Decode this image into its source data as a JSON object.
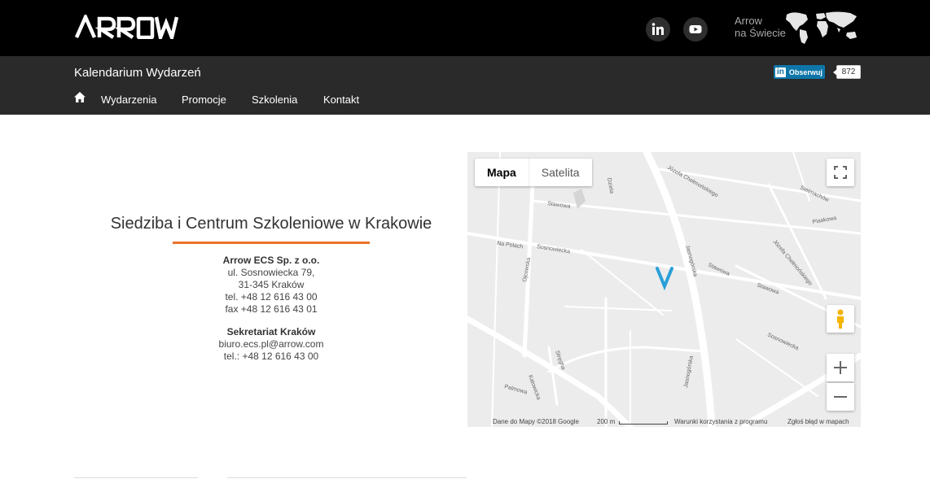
{
  "header": {
    "logo_text": "ARROW",
    "social": [
      "linkedin-icon",
      "youtube-icon"
    ],
    "world_line1": "Arrow",
    "world_line2": "na Świecie"
  },
  "navbar": {
    "title": "Kalendarium Wydarzeń",
    "follow_in": "in",
    "follow_label": "Obserwuj",
    "follow_count": "872",
    "menu": [
      "Wydarzenia",
      "Promocje",
      "Szkolenia",
      "Kontakt"
    ]
  },
  "office": {
    "title": "Siedziba i Centrum Szkoleniowe w Krakowie",
    "company": "Arrow ECS Sp. z o.o.",
    "street": "ul. Sosnowiecka 79,",
    "city": "31-345 Kraków",
    "tel": "tel. +48 12 616 43 00",
    "fax": "fax +48 12 616 43 01",
    "secretariat_title": "Sekretariat Kraków",
    "secretariat_email": "biuro.ecs.pl@arrow.com",
    "secretariat_tel": "tel.: +48 12 616 43 00"
  },
  "map": {
    "type_map": "Mapa",
    "type_satellite": "Satelita",
    "footer_data": "Dane do Mapy ©2018 Google",
    "footer_scale": "200 m",
    "footer_terms": "Warunki korzystania z programu",
    "footer_report": "Zgłoś błąd w mapach",
    "streets": {
      "s1": "Józefa Chełmońskiego",
      "s2": "Stawowa",
      "s3": "Na Polach",
      "s4": "Sosnowiecka",
      "s5": "Ojcowska",
      "s6": "Jasnogórska",
      "s7": "Piaskowa",
      "s8": "Palmowa",
      "s9": "Katowicka",
      "s10": "Stręgha",
      "s11": "Stelmachów",
      "s12": "Dziela"
    }
  }
}
